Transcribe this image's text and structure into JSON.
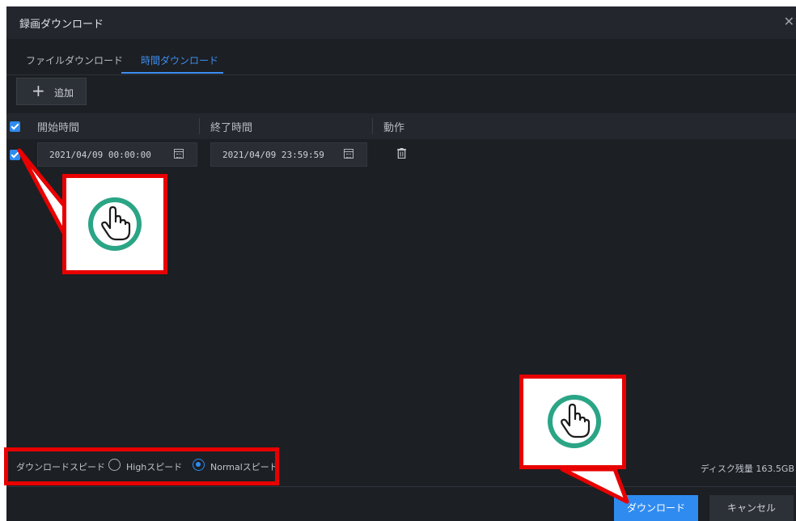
{
  "dialog": {
    "title": "録画ダウンロード",
    "close_icon": "close-icon"
  },
  "tabs": [
    {
      "label": "ファイルダウンロード",
      "active": false
    },
    {
      "label": "時間ダウンロード",
      "active": true
    }
  ],
  "toolbar": {
    "add_label": "追加",
    "add_icon": "plus-icon"
  },
  "table": {
    "headers": [
      "開始時間",
      "終了時間",
      "動作"
    ],
    "header_checked": true,
    "rows": [
      {
        "checked": true,
        "start": "2021/04/09 00:00:00",
        "end": "2021/04/09 23:59:59",
        "action_icon": "trash-icon"
      }
    ]
  },
  "download_speed": {
    "label": "ダウンロードスピード",
    "options": [
      {
        "label": "Highスピード",
        "selected": false
      },
      {
        "label": "Normalスピード",
        "selected": true
      }
    ]
  },
  "disk": {
    "text": "ディスク残量  163.5GB"
  },
  "footer": {
    "download_label": "ダウンロード",
    "cancel_label": "キャンセル"
  },
  "colors": {
    "accent": "#2f8bf0",
    "highlight": "#e80000",
    "hand_ring": "#2aa585"
  }
}
